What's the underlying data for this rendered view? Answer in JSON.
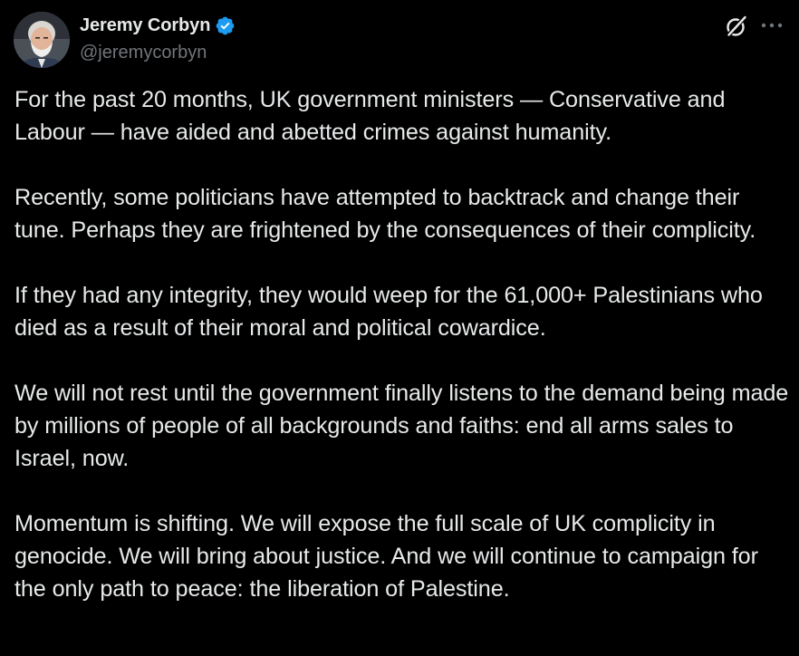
{
  "author": {
    "display_name": "Jeremy Corbyn",
    "handle": "@jeremycorbyn",
    "verified_icon": "verified-badge-icon",
    "avatar": "profile-photo"
  },
  "actions": {
    "grok_icon": "grok-icon",
    "more_icon": "more-options-icon"
  },
  "colors": {
    "background": "#000000",
    "text": "#e7e9ea",
    "secondary_text": "#71767b",
    "verified_blue": "#1d9bf0"
  },
  "tweet": {
    "paragraphs": [
      "For the past 20 months, UK government ministers — Conservative and Labour — have aided and abetted crimes against humanity.",
      "Recently, some politicians have attempted to backtrack and change their tune. Perhaps they are frightened by the consequences of their complicity.",
      "If they had any integrity, they would weep for the 61,000+ Palestinians who died as a result of their moral and political cowardice.",
      "We will not rest until the government finally listens to the demand being made by millions of people of all backgrounds and faiths: end all arms sales to Israel, now.",
      "Momentum is shifting. We will expose the full scale of UK complicity in genocide. We will bring about justice. And we will continue to campaign for the only path to peace: the liberation of Palestine."
    ]
  }
}
